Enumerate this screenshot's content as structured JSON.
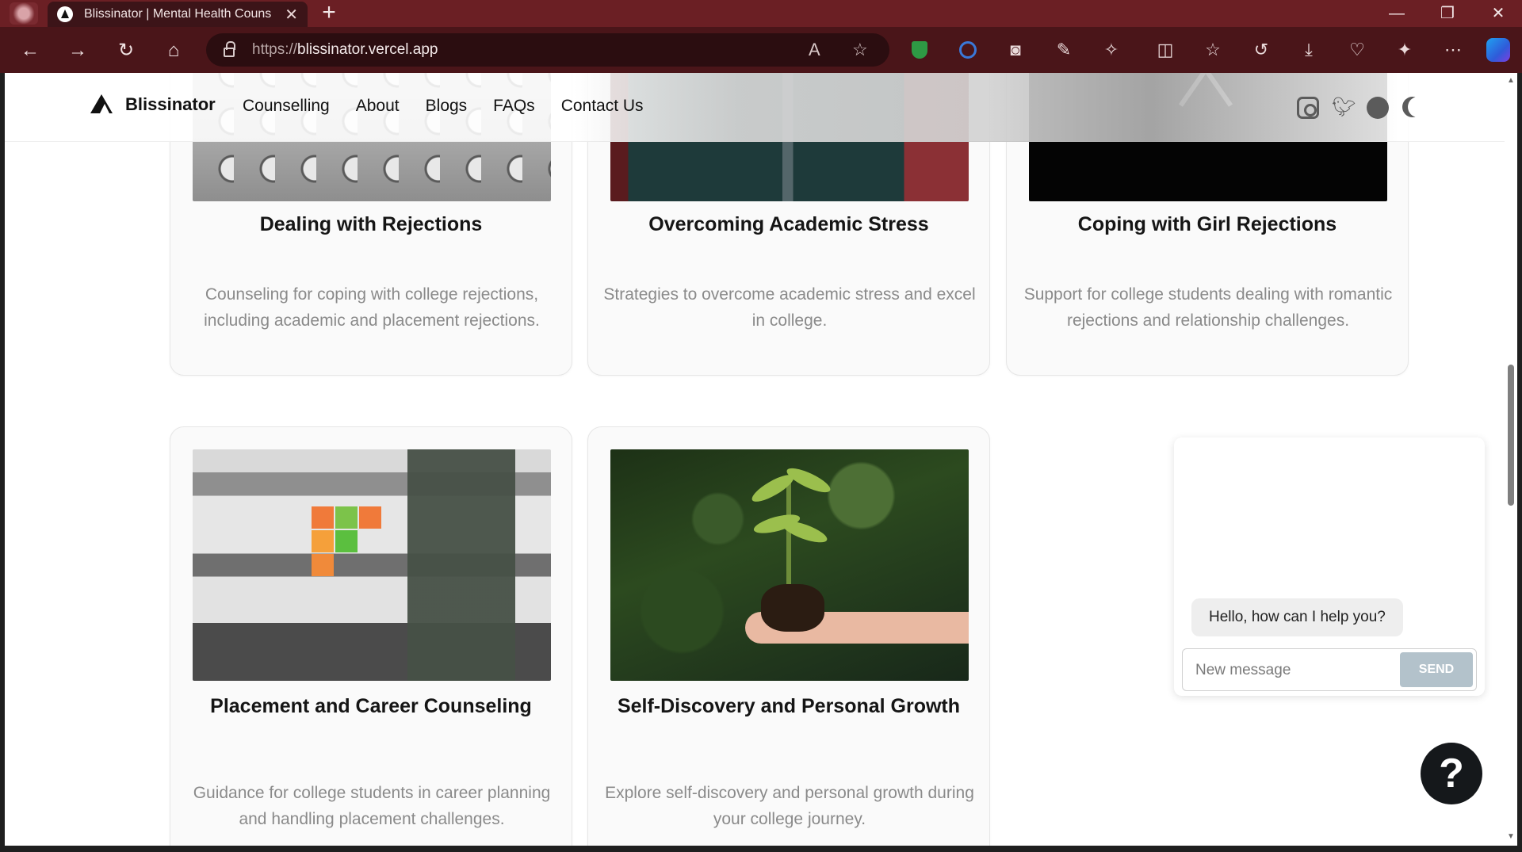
{
  "browser": {
    "tab_title": "Blissinator | Mental Health Couns",
    "tab_close": "✕",
    "new_tab": "+",
    "url_proto": "https://",
    "url_host": "blissinator.vercel.app",
    "window_controls": {
      "minimize": "—",
      "restore": "❐",
      "close": "✕"
    }
  },
  "site": {
    "brand": "Blissinator",
    "nav": [
      "Counselling",
      "About",
      "Blogs",
      "FAQs",
      "Contact Us"
    ]
  },
  "cards": [
    {
      "title": "Dealing with Rejections",
      "description": "Counseling for coping with college rejections, including academic and placement rejections."
    },
    {
      "title": "Overcoming Academic Stress",
      "description": "Strategies to overcome academic stress and excel in college."
    },
    {
      "title": "Coping with Girl Rejections",
      "description": "Support for college students dealing with romantic rejections and relationship challenges."
    },
    {
      "title": "Placement and Career Counseling",
      "description": "Guidance for college students in career planning and handling placement challenges."
    },
    {
      "title": "Self-Discovery and Personal Growth",
      "description": "Explore self-discovery and personal growth during your college journey."
    }
  ],
  "chat": {
    "greeting": "Hello, how can I help you?",
    "input_value": "",
    "input_placeholder": "New message",
    "send_label": "SEND"
  },
  "help_fab": "?",
  "colors": {
    "accent": "#15181b",
    "send_button": "#b3c2cb",
    "tabbar": "#6b1f24"
  }
}
